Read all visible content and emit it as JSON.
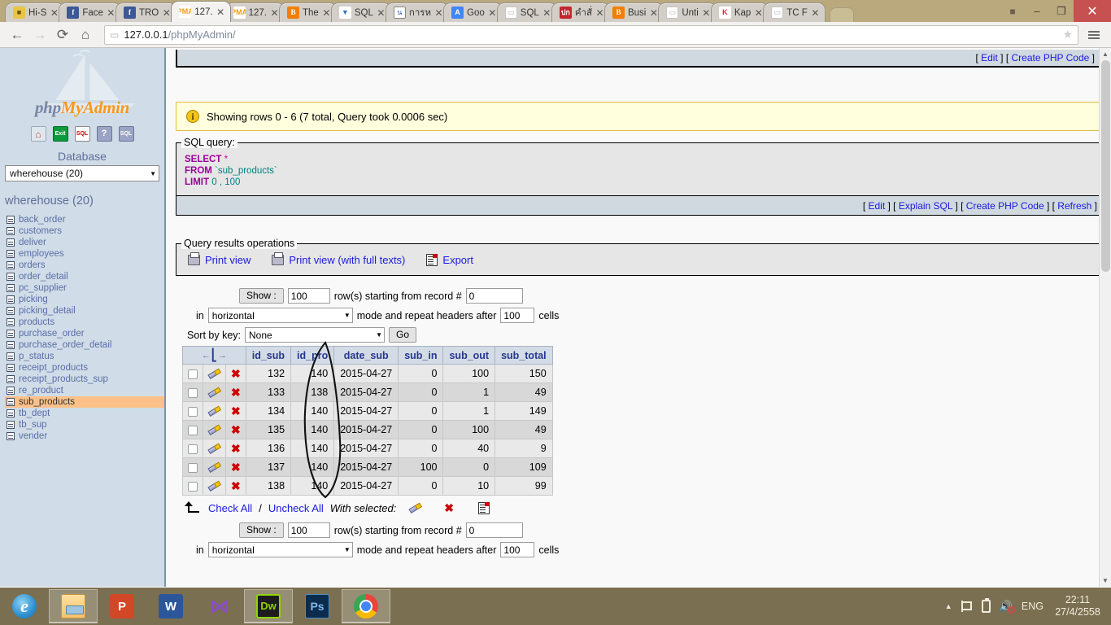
{
  "browser": {
    "tabs": [
      {
        "icon": "lock-icon",
        "favclass": "fav-lock",
        "glyph": "■",
        "title": "Hi-S",
        "active": false
      },
      {
        "icon": "facebook-icon",
        "favclass": "fav-fb",
        "glyph": "f",
        "title": "Face",
        "active": false
      },
      {
        "icon": "facebook-icon",
        "favclass": "fav-fb",
        "glyph": "f",
        "title": "TRO",
        "active": false
      },
      {
        "icon": "phpmyadmin-icon",
        "favclass": "fav-pma",
        "glyph": "PMA",
        "title": "127.",
        "active": true
      },
      {
        "icon": "phpmyadmin-icon",
        "favclass": "fav-pma",
        "glyph": "PMA",
        "title": "127.",
        "active": false
      },
      {
        "icon": "blogger-icon",
        "favclass": "fav-blogger",
        "glyph": "B",
        "title": "The",
        "active": false
      },
      {
        "icon": "sql-icon",
        "favclass": "fav-sql",
        "glyph": "▼",
        "title": "SQL",
        "active": false
      },
      {
        "icon": "thai-site-icon",
        "favclass": "fav-thai",
        "glyph": "น",
        "title": "การห",
        "active": false
      },
      {
        "icon": "google-icon",
        "favclass": "fav-goo",
        "glyph": "A",
        "title": "Goo",
        "active": false
      },
      {
        "icon": "document-icon",
        "favclass": "fav-doc",
        "glyph": "▭",
        "title": "SQL",
        "active": false
      },
      {
        "icon": "thai-news-icon",
        "favclass": "fav-red",
        "glyph": "ปก",
        "title": "คำสั่",
        "active": false
      },
      {
        "icon": "blogger-icon",
        "favclass": "fav-blogger",
        "glyph": "B",
        "title": "Busi",
        "active": false
      },
      {
        "icon": "document-icon",
        "favclass": "fav-doc",
        "glyph": "▭",
        "title": "Unti",
        "active": false
      },
      {
        "icon": "kapook-icon",
        "favclass": "fav-kap",
        "glyph": "K",
        "title": "Kap",
        "active": false
      },
      {
        "icon": "document-icon",
        "favclass": "fav-doc",
        "glyph": "▭",
        "title": "TC F",
        "active": false
      }
    ],
    "tab_close_glyph": "✕",
    "window_controls": {
      "user_icon": "user-account-icon",
      "user_glyph": "■",
      "minimize_glyph": "–",
      "restore_glyph": "❐",
      "close_glyph": "✕"
    },
    "toolbar": {
      "back_glyph": "←",
      "forward_glyph": "→",
      "reload_glyph": "⟳",
      "home_glyph": "⌂",
      "page_icon_glyph": "▭",
      "url_main": "127.0.0.1",
      "url_path": "/phpMyAdmin/",
      "star_glyph": "★"
    }
  },
  "sidebar": {
    "logo_part1": "php",
    "logo_part2": "MyAdmin",
    "icons": [
      {
        "name": "home-icon",
        "label": "⌂",
        "cls": "ni-home"
      },
      {
        "name": "log-out-icon",
        "label": "Exit",
        "cls": "ni-exit"
      },
      {
        "name": "sql-query-icon",
        "label": "SQL",
        "cls": "ni-sql"
      },
      {
        "name": "help-icon",
        "label": "?",
        "cls": "ni-help"
      },
      {
        "name": "sql-help-icon",
        "label": "SQL",
        "cls": "ni-sqlhelp"
      }
    ],
    "database_label": "Database",
    "database_selected": "wherehouse (20)",
    "db_title": "wherehouse (20)",
    "tables": [
      {
        "name": "back_order",
        "selected": false
      },
      {
        "name": "customers",
        "selected": false
      },
      {
        "name": "deliver",
        "selected": false
      },
      {
        "name": "employees",
        "selected": false
      },
      {
        "name": "orders",
        "selected": false
      },
      {
        "name": "order_detail",
        "selected": false
      },
      {
        "name": "pc_supplier",
        "selected": false
      },
      {
        "name": "picking",
        "selected": false
      },
      {
        "name": "picking_detail",
        "selected": false
      },
      {
        "name": "products",
        "selected": false
      },
      {
        "name": "purchase_order",
        "selected": false
      },
      {
        "name": "purchase_order_detail",
        "selected": false
      },
      {
        "name": "p_status",
        "selected": false
      },
      {
        "name": "receipt_products",
        "selected": false
      },
      {
        "name": "receipt_products_sup",
        "selected": false
      },
      {
        "name": "re_product",
        "selected": false
      },
      {
        "name": "sub_products",
        "selected": true
      },
      {
        "name": "tb_dept",
        "selected": false
      },
      {
        "name": "tb_sup",
        "selected": false
      },
      {
        "name": "vender",
        "selected": false
      }
    ]
  },
  "main": {
    "top_links": {
      "edit": "Edit",
      "create_php": "Create PHP Code"
    },
    "notice": "Showing rows 0 - 6 (7 total, Query took 0.0006 sec)",
    "sql_box": {
      "legend": "SQL query:",
      "line1_kw": "SELECT",
      "line1_op": "*",
      "line2_kw": "FROM",
      "line2_table": "`sub_products`",
      "line3_kw": "LIMIT",
      "line3_args": "0 , 100",
      "links": {
        "edit": "Edit",
        "explain": "Explain SQL",
        "create_php": "Create PHP Code",
        "refresh": "Refresh"
      }
    },
    "query_ops": {
      "legend": "Query results operations",
      "print_view": "Print view",
      "print_view_full": "Print view (with full texts)",
      "export": "Export"
    },
    "controls_top": {
      "show_button": "Show :",
      "rows_value": "100",
      "rows_text": "row(s) starting from record #",
      "record_value": "0",
      "in_text": "in",
      "mode_value": "horizontal",
      "mode_text": "mode and repeat headers after",
      "headers_value": "100",
      "cells_text": "cells",
      "sort_label": "Sort by key:",
      "sort_value": "None",
      "go_button": "Go"
    },
    "table": {
      "sort_header": "←─→",
      "columns": [
        "id_sub",
        "id_pro",
        "date_sub",
        "sub_in",
        "sub_out",
        "sub_total"
      ],
      "rows": [
        {
          "id_sub": "132",
          "id_pro": "140",
          "date_sub": "2015-04-27",
          "sub_in": "0",
          "sub_out": "100",
          "sub_total": "150"
        },
        {
          "id_sub": "133",
          "id_pro": "138",
          "date_sub": "2015-04-27",
          "sub_in": "0",
          "sub_out": "1",
          "sub_total": "49"
        },
        {
          "id_sub": "134",
          "id_pro": "140",
          "date_sub": "2015-04-27",
          "sub_in": "0",
          "sub_out": "1",
          "sub_total": "149"
        },
        {
          "id_sub": "135",
          "id_pro": "140",
          "date_sub": "2015-04-27",
          "sub_in": "0",
          "sub_out": "100",
          "sub_total": "49"
        },
        {
          "id_sub": "136",
          "id_pro": "140",
          "date_sub": "2015-04-27",
          "sub_in": "0",
          "sub_out": "40",
          "sub_total": "9"
        },
        {
          "id_sub": "137",
          "id_pro": "140",
          "date_sub": "2015-04-27",
          "sub_in": "100",
          "sub_out": "0",
          "sub_total": "109"
        },
        {
          "id_sub": "138",
          "id_pro": "140",
          "date_sub": "2015-04-27",
          "sub_in": "0",
          "sub_out": "10",
          "sub_total": "99"
        }
      ]
    },
    "check_all": {
      "check_all": "Check All",
      "separator": "/",
      "uncheck_all": "Uncheck All",
      "with_selected": "With selected:"
    },
    "controls_bottom": {
      "show_button": "Show :",
      "rows_value": "100",
      "rows_text": "row(s) starting from record #",
      "record_value": "0",
      "in_text": "in",
      "mode_value": "horizontal",
      "mode_text": "mode and repeat headers after",
      "headers_value": "100",
      "cells_text": "cells"
    },
    "annotation": "hand-drawn-ellipse-around-id_pro-column"
  },
  "taskbar": {
    "items": [
      {
        "name": "internet-explorer",
        "cls": "ic-ie",
        "glyph": "e",
        "active": false
      },
      {
        "name": "file-explorer",
        "cls": "ic-folder",
        "glyph": "",
        "active": true
      },
      {
        "name": "powerpoint",
        "cls": "ic-ppt",
        "glyph": "P",
        "active": false
      },
      {
        "name": "word",
        "cls": "ic-word",
        "glyph": "W",
        "active": false
      },
      {
        "name": "movie-maker",
        "cls": "ic-mm",
        "glyph": "⋈",
        "active": false
      },
      {
        "name": "dreamweaver",
        "cls": "ic-dw",
        "glyph": "Dw",
        "active": true
      },
      {
        "name": "photoshop",
        "cls": "ic-ps",
        "glyph": "Ps",
        "active": false
      },
      {
        "name": "google-chrome",
        "cls": "ic-chrome",
        "glyph": "",
        "active": true
      }
    ],
    "tray": {
      "show_hidden_glyph": "▲",
      "action_center": "flag-icon",
      "battery": "battery-icon",
      "volume_glyph": "🔊",
      "language": "ENG",
      "time": "22:11",
      "date": "27/4/2558"
    }
  },
  "colors": {
    "accent_orange": "#f8981d",
    "link_blue": "#1a1ae0",
    "sidebar_bg": "#d0dce7",
    "selected_row": "#fbc189",
    "notice_bg": "#ffffdd",
    "taskbar_bg": "#7a6f50",
    "chrome_titlebar": "#b9a97d"
  }
}
